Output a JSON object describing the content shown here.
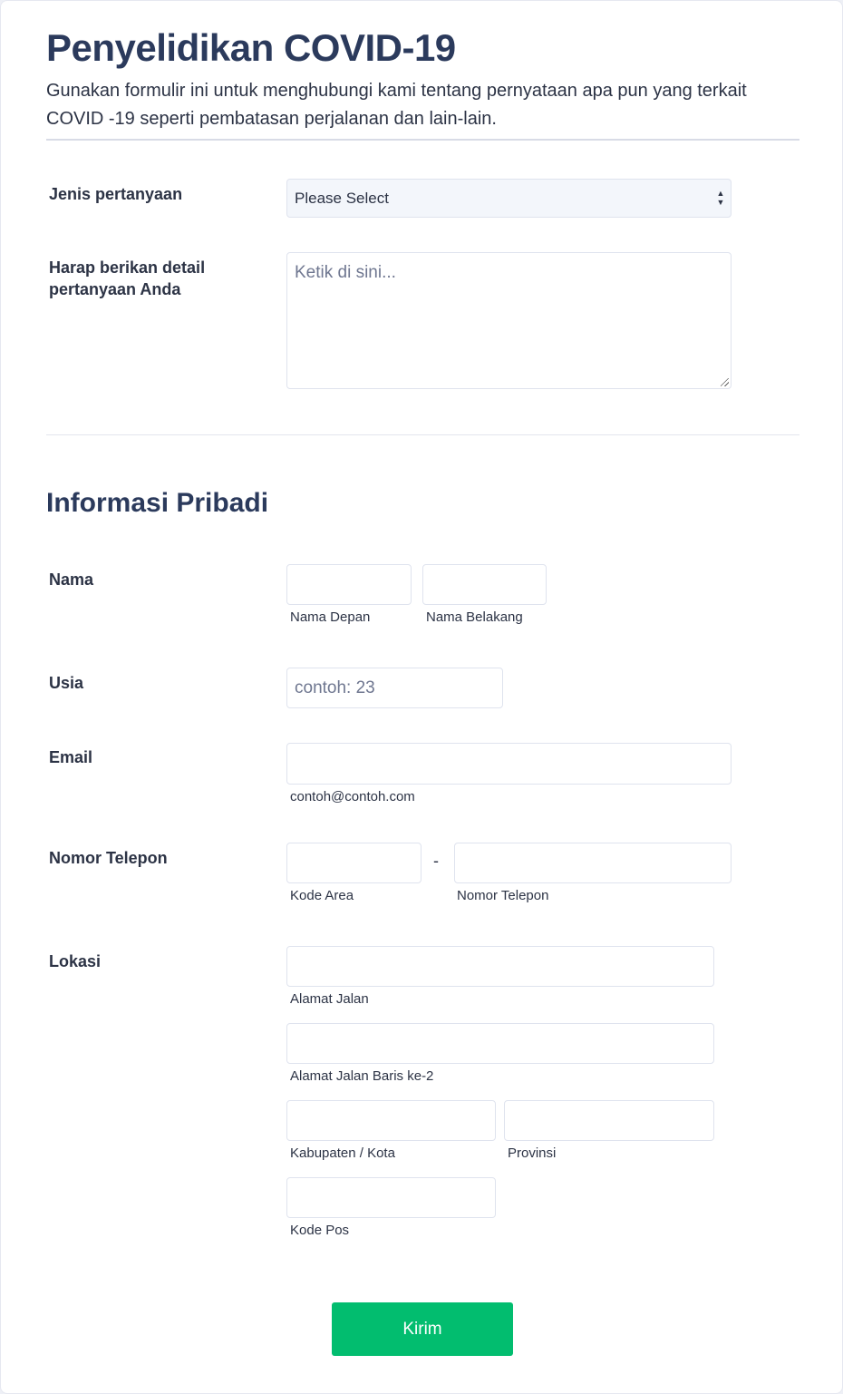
{
  "form": {
    "title": "Penyelidikan COVID-19",
    "description": "Gunakan formulir ini untuk menghubungi kami tentang pernyataan apa pun yang terkait COVID -19 seperti pembatasan perjalanan dan lain-lain.",
    "inquiry_type": {
      "label": "Jenis pertanyaan",
      "selected": "Please Select",
      "icon": "up-down-arrows-icon"
    },
    "inquiry_detail": {
      "label": "Harap berikan detail pertanyaan Anda",
      "placeholder": "Ketik di sini..."
    }
  },
  "personal": {
    "section_title": "Informasi Pribadi",
    "name": {
      "label": "Nama",
      "first_sublabel": "Nama Depan",
      "last_sublabel": "Nama Belakang",
      "first_value": "",
      "last_value": ""
    },
    "age": {
      "label": "Usia",
      "placeholder": "contoh: 23"
    },
    "email": {
      "label": "Email",
      "value": "",
      "sublabel": "contoh@contoh.com"
    },
    "phone": {
      "label": "Nomor Telepon",
      "separator": "-",
      "area_sublabel": "Kode Area",
      "number_sublabel": "Nomor Telepon"
    },
    "location": {
      "label": "Lokasi",
      "street_sublabel": "Alamat Jalan",
      "street2_sublabel": "Alamat Jalan Baris ke-2",
      "city_sublabel": "Kabupaten / Kota",
      "province_sublabel": "Provinsi",
      "postal_sublabel": "Kode Pos"
    }
  },
  "submit": {
    "label": "Kirim"
  },
  "colors": {
    "heading": "#2b3a5c",
    "text": "#2c3345",
    "submit_bg": "#02bd6f",
    "field_border": "#dfe3ee",
    "select_bg": "#f3f6fb"
  }
}
